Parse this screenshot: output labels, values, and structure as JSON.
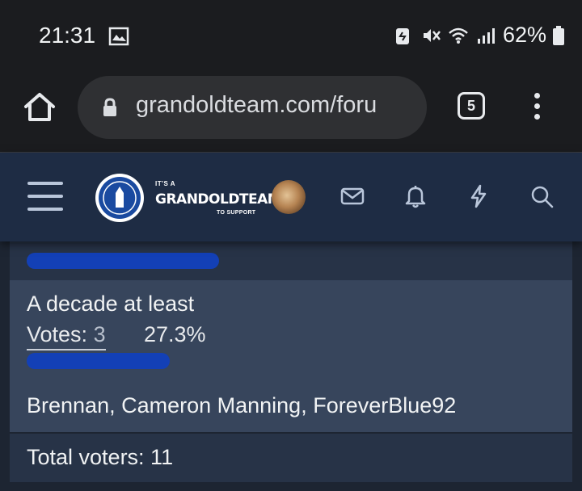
{
  "status_bar": {
    "time": "21:31",
    "battery_percent": "62%"
  },
  "browser": {
    "url": "grandoldteam.com/foru",
    "tab_count": "5"
  },
  "site_header": {
    "brand_top": "IT'S A",
    "brand_main": "GRANDOLDTEAM",
    "brand_bottom": "TO SUPPORT"
  },
  "poll": {
    "choice_label": "A decade at least",
    "votes_label": "Votes: ",
    "votes_count": "3",
    "percent": "27.3%",
    "percent_value": 27.3,
    "voters": "Brennan, Cameron Manning, ForeverBlue92",
    "total_voters": "Total voters: 11",
    "bar_color": "#1340b6"
  }
}
